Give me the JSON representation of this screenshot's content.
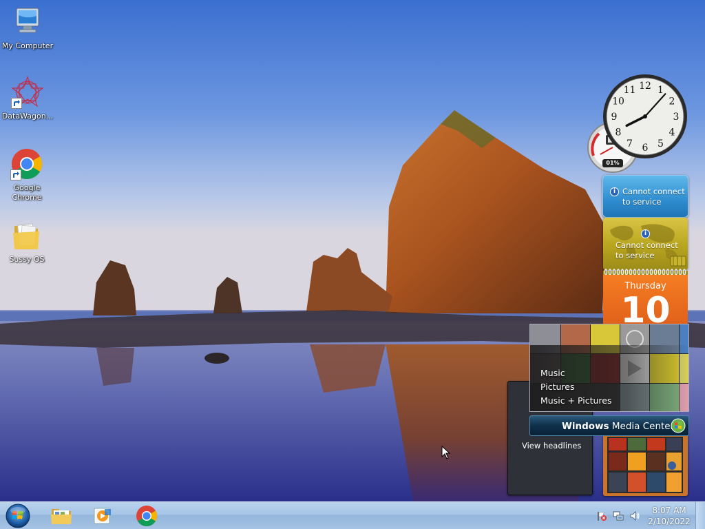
{
  "desktop": {
    "icons": [
      {
        "label": "My Computer"
      },
      {
        "label": "DataWagon..."
      },
      {
        "label": "Google Chrome"
      },
      {
        "label": "Sussy OS"
      }
    ]
  },
  "gadgets": {
    "cpu_meter": {
      "percent_text": "01%",
      "cpu_value": 0.01
    },
    "weather": {
      "message_line1": "Cannot connect",
      "message_line2": "to service"
    },
    "currency": {
      "message_line1": "Cannot connect",
      "message_line2": "to service"
    },
    "calendar": {
      "day_name": "Thursday",
      "day_number": "10"
    },
    "feed_headlines": {
      "link": "View headlines"
    },
    "media_center": {
      "title_bold": "Windows",
      "title_rest": "Media Center",
      "menu": [
        "Music",
        "Pictures",
        "Music + Pictures"
      ]
    },
    "clock": {
      "numerals": [
        "12",
        "1",
        "2",
        "3",
        "4",
        "5",
        "6",
        "7",
        "8",
        "9",
        "10",
        "11"
      ],
      "time_shown": "8:07"
    }
  },
  "taskbar": {
    "pinned": [
      {
        "icon": "file-explorer-icon"
      },
      {
        "icon": "media-player-icon"
      },
      {
        "icon": "chrome-icon"
      }
    ],
    "tray": {
      "time": "8:07 AM",
      "date": "2/10/2022",
      "icons": [
        "action-center-flag-icon",
        "network-icon",
        "volume-icon"
      ]
    }
  },
  "colors": {
    "taskbar": "#a6c4e6",
    "calendar": "#f06e1f",
    "weather": "#2f8dcf",
    "currency": "#b8a51e",
    "wmc_bar": "#0e2f4a"
  }
}
